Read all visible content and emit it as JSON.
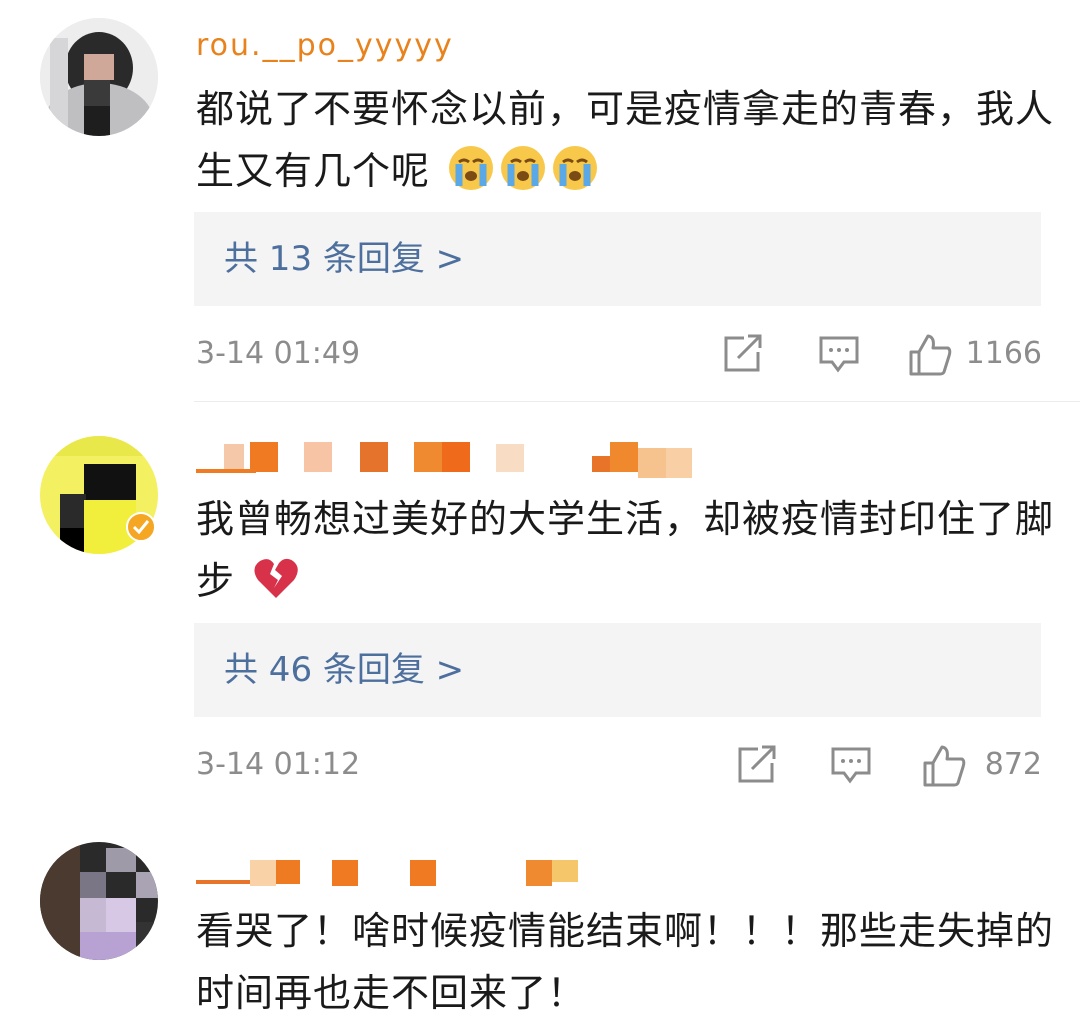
{
  "comments": [
    {
      "username": "rou.__po_yyyyy",
      "text": "都说了不要怀念以前，可是疫情拿走的青春，我人生又有几个呢",
      "emoji": [
        "crying-face",
        "crying-face",
        "crying-face"
      ],
      "replies_label": "共 13 条回复 >",
      "time": "3-14 01:49",
      "likes": "1166"
    },
    {
      "username": "",
      "text": "我曾畅想过美好的大学生活，却被疫情封印住了脚步",
      "emoji": [
        "broken-heart"
      ],
      "replies_label": "共 46 条回复 >",
      "time": "3-14 01:12",
      "likes": "872"
    },
    {
      "username": "",
      "text": "看哭了！啥时候疫情能结束啊！！！那些走失掉的时间再也走不回来了！",
      "emoji": []
    }
  ],
  "colors": {
    "reply_link": "#4d6f9d",
    "meta_gray": "#8c8c8c",
    "reply_bg": "#f4f4f4",
    "username_orange": "#e8821c"
  }
}
